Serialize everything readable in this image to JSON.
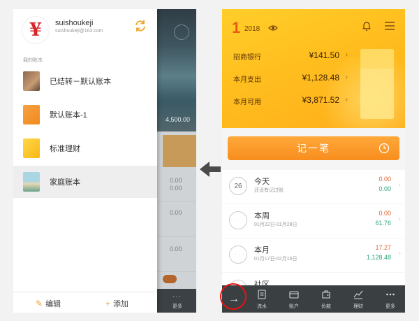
{
  "left": {
    "user": {
      "avatar_glyph": "¥",
      "name": "suishoukeji",
      "email": "suishoukeji@163.com"
    },
    "section_label": "我的账本",
    "books": [
      {
        "name": "已结转－默认账本",
        "cover": "photo-brown"
      },
      {
        "name": "默认账本-1",
        "cover": "orange"
      },
      {
        "name": "标准理财",
        "cover": "yellow"
      },
      {
        "name": "家庭账本",
        "cover": "photo-family"
      }
    ],
    "active_book_index": 3,
    "footer": {
      "edit_label": "编辑",
      "add_label": "添加"
    },
    "background": {
      "amount": "4,500.00",
      "row_values": [
        "0.00",
        "0.00",
        "0.00",
        "0.00"
      ],
      "more_label": "更多"
    }
  },
  "right": {
    "header": {
      "month": "1",
      "year": "2018"
    },
    "summary": [
      {
        "label": "招商银行",
        "amount": "¥141.50"
      },
      {
        "label": "本月支出",
        "amount": "¥1,128.48"
      },
      {
        "label": "本月可用",
        "amount": "¥3,871.52"
      }
    ],
    "record_button": "记一笔",
    "periods": [
      {
        "title": "今天",
        "subtitle": "还没有记过账",
        "out": "0.00",
        "in": "0.00",
        "icon_text": "26"
      },
      {
        "title": "本周",
        "subtitle": "01月22日-01月28日",
        "out": "0.00",
        "in": "61.76",
        "icon_text": ""
      },
      {
        "title": "本月",
        "subtitle": "01月17日-02月16日",
        "out": "17.27",
        "in": "1,128.48",
        "icon_text": ""
      },
      {
        "title": "社区",
        "subtitle": "",
        "out": "",
        "in": "",
        "icon_text": ""
      }
    ],
    "tabs": [
      {
        "label": "流水",
        "icon": "document-icon"
      },
      {
        "label": "账户",
        "icon": "wallet-icon"
      },
      {
        "label": "负款",
        "icon": "money-bag-icon"
      },
      {
        "label": "理财",
        "icon": "chart-icon"
      },
      {
        "label": "更多",
        "icon": "more-dots-icon"
      }
    ],
    "colors": {
      "accent_orange": "#f78e1e",
      "hero_yellow": "#ffbe1e",
      "expense": "#e0612e",
      "income": "#2ba57a",
      "highlight": "#e11111"
    }
  }
}
